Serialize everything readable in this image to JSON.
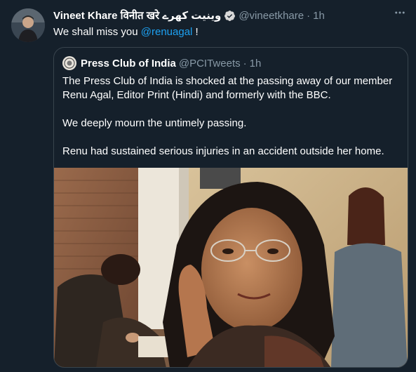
{
  "tweet": {
    "author_name": "Vineet Khare विनीत खरे وینیت کھرے",
    "verified": true,
    "handle": "@vineetkhare",
    "dot": "·",
    "time": "1h",
    "text_prefix": "We shall miss you ",
    "mention": "@renuagal",
    "text_suffix": " !"
  },
  "quoted_tweet": {
    "author_name": "Press Club of India",
    "handle": "@PCITweets",
    "dot": "·",
    "time": "1h",
    "paragraphs": [
      "The Press Club of India is shocked at the passing away of our member Renu Agal, Editor Print (Hindi) and formerly with the BBC.",
      "We deeply mourn the untimely passing.",
      "Renu had sustained serious injuries in an accident outside her home."
    ]
  },
  "icons": {
    "verified": "verified-badge-icon",
    "more": "more-options-icon"
  },
  "colors": {
    "background": "#15202b",
    "text_primary": "#ffffff",
    "text_secondary": "#8899a6",
    "accent": "#1da1f2",
    "border": "#38444d"
  }
}
